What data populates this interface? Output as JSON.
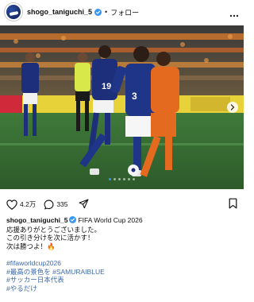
{
  "header": {
    "username": "shogo_taniguchi_5",
    "follow_label": "フォロー",
    "separator": "•"
  },
  "post": {
    "image_alt": "Japan vs Netherlands World Cup match action",
    "jersey_numbers": [
      "3",
      "19"
    ],
    "carousel_total": 6,
    "carousel_active": 1
  },
  "actions": {
    "likes": "4.2万",
    "comments": "335"
  },
  "caption": {
    "username": "shogo_taniguchi_5",
    "title": "FIFA World Cup 2026",
    "line1": "応援ありがとうございました。",
    "line2": "この引き分けを次に活かす！",
    "line3": "次は勝つよ！🔥",
    "hashtags": [
      "#fifaworldcup2026",
      "#最高の景色を #SAMURAIBLUE",
      "#サッカー日本代表",
      "#やるだけ"
    ]
  },
  "colors": {
    "link": "#3b6aa8",
    "verified": "#3897f0",
    "japan_blue": "#1d2f7a",
    "netherlands_orange": "#e36a1e"
  }
}
